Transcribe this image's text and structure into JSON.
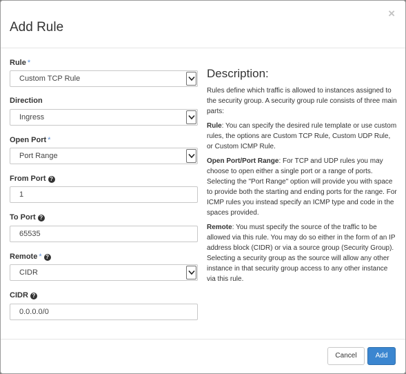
{
  "dialog": {
    "title": "Add Rule",
    "close_label": "×"
  },
  "form": {
    "required_mark": "*",
    "help_glyph": "?",
    "rule": {
      "label": "Rule",
      "value": "Custom TCP Rule"
    },
    "direction": {
      "label": "Direction",
      "value": "Ingress"
    },
    "open_port": {
      "label": "Open Port",
      "value": "Port Range"
    },
    "from_port": {
      "label": "From Port",
      "value": "1"
    },
    "to_port": {
      "label": "To Port",
      "value": "65535"
    },
    "remote": {
      "label": "Remote",
      "value": "CIDR"
    },
    "cidr": {
      "label": "CIDR",
      "value": "0.0.0.0/0"
    }
  },
  "description": {
    "title": "Description:",
    "intro": "Rules define which traffic is allowed to instances assigned to the security group. A security group rule consists of three main parts:",
    "rule_term": "Rule",
    "rule_text": ": You can specify the desired rule template or use custom rules, the options are Custom TCP Rule, Custom UDP Rule, or Custom ICMP Rule.",
    "port_term": "Open Port/Port Range",
    "port_text": ": For TCP and UDP rules you may choose to open either a single port or a range of ports. Selecting the \"Port Range\" option will provide you with space to provide both the starting and ending ports for the range. For ICMP rules you instead specify an ICMP type and code in the spaces provided.",
    "remote_term": "Remote",
    "remote_text": ": You must specify the source of the traffic to be allowed via this rule. You may do so either in the form of an IP address block (CIDR) or via a source group (Security Group). Selecting a security group as the source will allow any other instance in that security group access to any other instance via this rule."
  },
  "footer": {
    "cancel_label": "Cancel",
    "add_label": "Add"
  },
  "colors": {
    "primary": "#3b86d0",
    "required": "#5b8fd6",
    "backdrop": "#7d7d7d"
  }
}
